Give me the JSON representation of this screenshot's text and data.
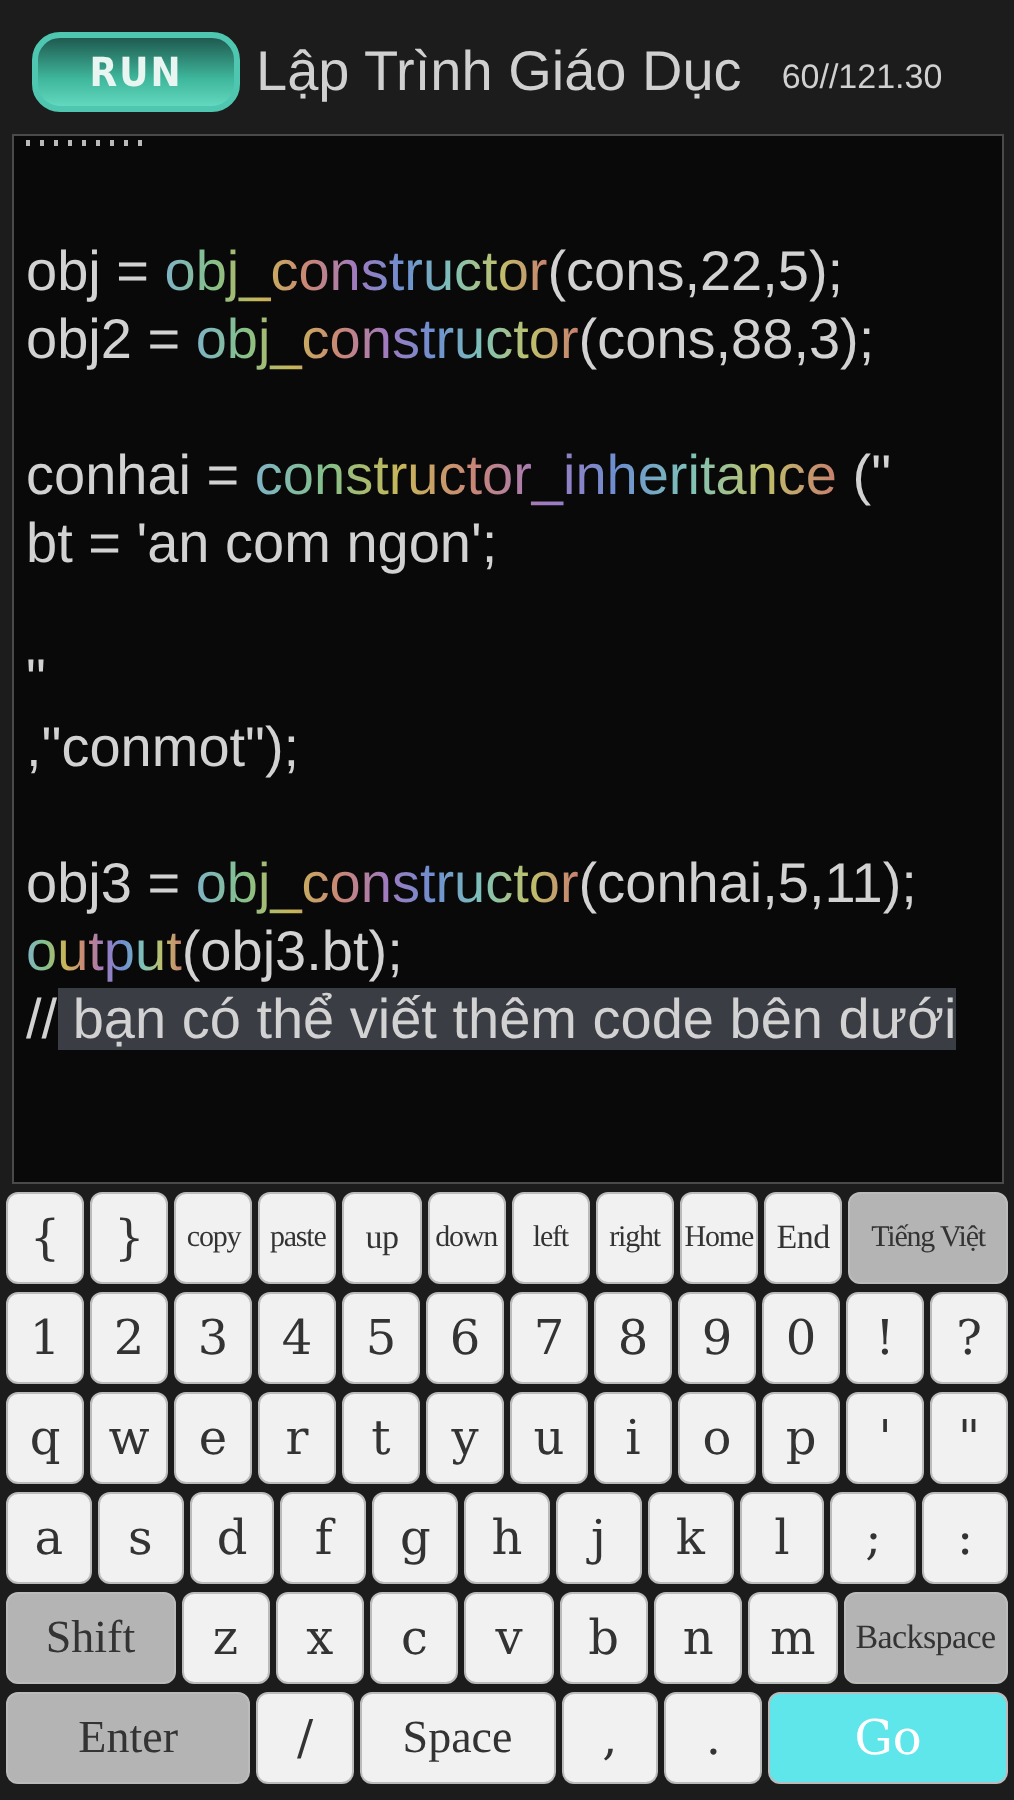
{
  "header": {
    "run_button": "RUN",
    "title": "Lập Trình Giáo Dục",
    "counter": "60//121.30"
  },
  "editor": {
    "blocks": [
      [
        [
          {
            "kind": "plain",
            "text": "obj = "
          },
          {
            "kind": "func",
            "text": "obj_constructor"
          },
          {
            "kind": "plain",
            "text": "(cons,22,5);"
          }
        ],
        [
          {
            "kind": "plain",
            "text": "obj2 = "
          },
          {
            "kind": "func",
            "text": "obj_constructor"
          },
          {
            "kind": "plain",
            "text": "(cons,88,3);"
          }
        ]
      ],
      [
        [
          {
            "kind": "plain",
            "text": "conhai = "
          },
          {
            "kind": "func",
            "text": "constructor_inheritance"
          },
          {
            "kind": "plain",
            "text": " (\""
          }
        ],
        [
          {
            "kind": "plain",
            "text": "bt = 'an com ngon';"
          }
        ]
      ],
      [
        [
          {
            "kind": "plain",
            "text": "\""
          }
        ],
        [
          {
            "kind": "plain",
            "text": ",\"conmot\");"
          }
        ]
      ],
      [
        [
          {
            "kind": "plain",
            "text": "obj3 = "
          },
          {
            "kind": "func",
            "text": "obj_constructor"
          },
          {
            "kind": "plain",
            "text": "(conhai,5,11);"
          }
        ],
        [
          {
            "kind": "func",
            "text": "output"
          },
          {
            "kind": "plain",
            "text": "(obj3.bt);"
          }
        ],
        [
          {
            "kind": "plain",
            "text": "//"
          },
          {
            "kind": "selection",
            "text": " bạn có thể viết thêm code bên dưới"
          }
        ]
      ]
    ]
  },
  "keyboard": {
    "key_rows": [
      {
        "keys": [
          {
            "label": "{",
            "kind": "char"
          },
          {
            "label": "}",
            "kind": "char"
          },
          {
            "label": "copy",
            "kind": "char"
          },
          {
            "label": "paste",
            "kind": "char"
          },
          {
            "label": "up",
            "kind": "char"
          },
          {
            "label": "down",
            "kind": "char"
          },
          {
            "label": "left",
            "kind": "char"
          },
          {
            "label": "right",
            "kind": "char"
          },
          {
            "label": "Home",
            "kind": "char"
          },
          {
            "label": "End",
            "kind": "char"
          },
          {
            "label": "Tiếng Việt",
            "kind": "mod"
          }
        ]
      },
      {
        "keys": [
          {
            "label": "1",
            "kind": "char"
          },
          {
            "label": "2",
            "kind": "char"
          },
          {
            "label": "3",
            "kind": "char"
          },
          {
            "label": "4",
            "kind": "char"
          },
          {
            "label": "5",
            "kind": "char"
          },
          {
            "label": "6",
            "kind": "char"
          },
          {
            "label": "7",
            "kind": "char"
          },
          {
            "label": "8",
            "kind": "char"
          },
          {
            "label": "9",
            "kind": "char"
          },
          {
            "label": "0",
            "kind": "char"
          },
          {
            "label": "!",
            "kind": "char"
          },
          {
            "label": "?",
            "kind": "char"
          }
        ]
      },
      {
        "keys": [
          {
            "label": "q",
            "kind": "char"
          },
          {
            "label": "w",
            "kind": "char"
          },
          {
            "label": "e",
            "kind": "char"
          },
          {
            "label": "r",
            "kind": "char"
          },
          {
            "label": "t",
            "kind": "char"
          },
          {
            "label": "y",
            "kind": "char"
          },
          {
            "label": "u",
            "kind": "char"
          },
          {
            "label": "i",
            "kind": "char"
          },
          {
            "label": "o",
            "kind": "char"
          },
          {
            "label": "p",
            "kind": "char"
          },
          {
            "label": "'",
            "kind": "char"
          },
          {
            "label": "\"",
            "kind": "char"
          }
        ]
      },
      {
        "keys": [
          {
            "label": "a",
            "kind": "char"
          },
          {
            "label": "s",
            "kind": "char"
          },
          {
            "label": "d",
            "kind": "char"
          },
          {
            "label": "f",
            "kind": "char"
          },
          {
            "label": "g",
            "kind": "char"
          },
          {
            "label": "h",
            "kind": "char"
          },
          {
            "label": "j",
            "kind": "char"
          },
          {
            "label": "k",
            "kind": "char"
          },
          {
            "label": "l",
            "kind": "char"
          },
          {
            "label": ";",
            "kind": "char"
          },
          {
            "label": ":",
            "kind": "char"
          }
        ]
      },
      {
        "keys": [
          {
            "label": "Shift",
            "kind": "mod"
          },
          {
            "label": "z",
            "kind": "char"
          },
          {
            "label": "x",
            "kind": "char"
          },
          {
            "label": "c",
            "kind": "char"
          },
          {
            "label": "v",
            "kind": "char"
          },
          {
            "label": "b",
            "kind": "char"
          },
          {
            "label": "n",
            "kind": "char"
          },
          {
            "label": "m",
            "kind": "char"
          },
          {
            "label": "Backspace",
            "kind": "mod"
          }
        ]
      },
      {
        "keys": [
          {
            "label": "Enter",
            "kind": "mod"
          },
          {
            "label": "/",
            "kind": "char"
          },
          {
            "label": "Space",
            "kind": "char"
          },
          {
            "label": ",",
            "kind": "char"
          },
          {
            "label": ".",
            "kind": "char"
          },
          {
            "label": "Go",
            "kind": "go"
          }
        ]
      }
    ]
  }
}
